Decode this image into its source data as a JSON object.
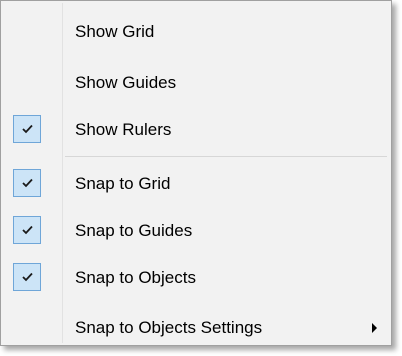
{
  "menu": {
    "items": [
      {
        "label": "Show Grid",
        "checked": false
      },
      {
        "label": "Show Guides",
        "checked": false
      },
      {
        "label": "Show Rulers",
        "checked": true
      },
      {
        "label": "Snap to Grid",
        "checked": true
      },
      {
        "label": "Snap to Guides",
        "checked": true
      },
      {
        "label": "Snap to Objects",
        "checked": true
      },
      {
        "label": "Snap to Objects Settings",
        "checked": false,
        "submenu": true
      }
    ],
    "icons": {
      "check": "checkmark-icon",
      "submenu": "submenu-arrow-icon"
    },
    "colors": {
      "background": "#f2f2f2",
      "check_fill": "#cce4f7",
      "check_border": "#6fa6d8"
    }
  }
}
